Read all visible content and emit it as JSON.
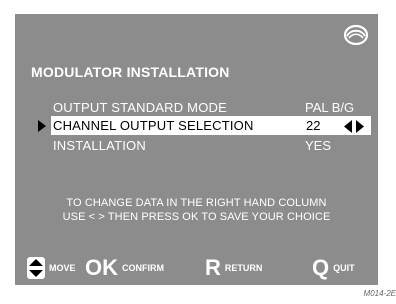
{
  "screen": {
    "title": "MODULATOR INSTALLATION",
    "logo_icon": "brand-logo-icon",
    "menu": [
      {
        "label": "OUTPUT STANDARD MODE",
        "value": "PAL B/G"
      },
      {
        "label": "CHANNEL OUTPUT SELECTION",
        "value": "22",
        "selected": true
      },
      {
        "label": "INSTALLATION",
        "value": "YES"
      }
    ],
    "help": [
      "TO CHANGE DATA IN THE RIGHT HAND COLUMN",
      "USE < > THEN PRESS OK TO SAVE YOUR CHOICE"
    ],
    "legend": [
      {
        "icon": "up-down-arrows-icon",
        "label": "MOVE"
      },
      {
        "icon": "ok-key",
        "key": "OK",
        "label": "CONFIRM"
      },
      {
        "icon": "r-key",
        "key": "R",
        "label": "RETURN"
      },
      {
        "icon": "q-key",
        "key": "Q",
        "label": "QUIT"
      }
    ]
  },
  "figure_ref": "M014-2E",
  "colors": {
    "screen_bg": "#8c8c8c",
    "text": "#ffffff",
    "selected_bg": "#ffffff",
    "selected_text": "#000000"
  }
}
